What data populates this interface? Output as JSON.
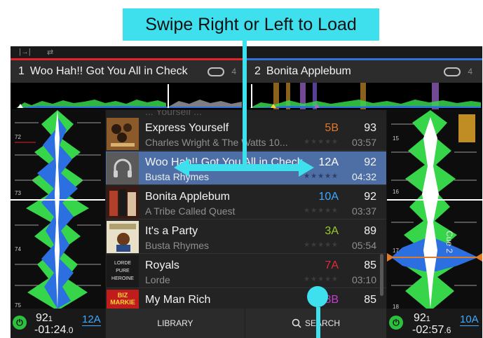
{
  "callout": {
    "text": "Swipe Right or Left to Load"
  },
  "colors": {
    "callout": "#3fe0ee",
    "deck1": "#e0242a",
    "deck2": "#2f74d8",
    "selected_row": "#4e6fa6",
    "waveform_green": "#37d64a",
    "waveform_blue": "#2b6fe0"
  },
  "deck1": {
    "number": "1",
    "title": "Woo Hah!! Got You All in Check",
    "loop_icon": "loop-icon",
    "loop_count": "4",
    "bpm": "92",
    "bpm_decimal": "1",
    "time": "-01:24",
    "time_decimal": ".0",
    "key": "12A",
    "beat_markers": [
      "72",
      "73",
      "74",
      "75"
    ]
  },
  "deck2": {
    "number": "2",
    "title": "Bonita Applebum",
    "loop_icon": "loop-icon",
    "loop_count": "4",
    "bpm": "92",
    "bpm_decimal": "1",
    "time": "-02:57",
    "time_decimal": ".6",
    "key": "10A",
    "beat_markers": [
      "15",
      "16",
      "17",
      "18"
    ],
    "cue_label": "Cue 2"
  },
  "library": {
    "partial_top": "... Yourself ...",
    "tracks": [
      {
        "title": "Express Yourself",
        "artist": "Charles Wright & The Watts 10...",
        "key": "5B",
        "key_color": "#e0772a",
        "bpm": "93",
        "length": "03:57",
        "rating": "★★★★★",
        "art": "album-art-express"
      },
      {
        "title": "Woo Hah!! Got You All in Check",
        "artist": "Busta Rhymes",
        "key": "12A",
        "key_color": "#ffffff",
        "bpm": "92",
        "length": "04:32",
        "rating": "★★★★★",
        "art": "album-art-placeholder",
        "selected": true
      },
      {
        "title": "Bonita Applebum",
        "artist": "A Tribe Called Quest",
        "key": "10A",
        "key_color": "#3fa9ff",
        "bpm": "92",
        "length": "03:37",
        "rating": "★★★★★",
        "art": "album-art-tribe"
      },
      {
        "title": "It's a Party",
        "artist": "Busta Rhymes",
        "key": "3A",
        "key_color": "#9acb2c",
        "bpm": "89",
        "length": "05:54",
        "rating": "★★★★★",
        "art": "album-art-party"
      },
      {
        "title": "Royals",
        "artist": "Lorde",
        "key": "7A",
        "key_color": "#e02a3a",
        "bpm": "85",
        "length": "03:10",
        "rating": "★★★★★",
        "art": "album-art-lorde"
      },
      {
        "title": "My Man Rich",
        "artist": "",
        "key": "8B",
        "key_color": "#c23ed0",
        "bpm": "85",
        "length": "",
        "rating": "",
        "art": "album-art-bizmarkie"
      }
    ],
    "lorde_art_text": [
      "LORDE",
      "PURE",
      "HEROINE"
    ],
    "biz_art_text": "BIZ MARKIE"
  },
  "bottom": {
    "library_label": "LIBRARY",
    "search_label": "SEARCH",
    "search_icon": "search-icon",
    "sync_icon": "sync-icon"
  }
}
